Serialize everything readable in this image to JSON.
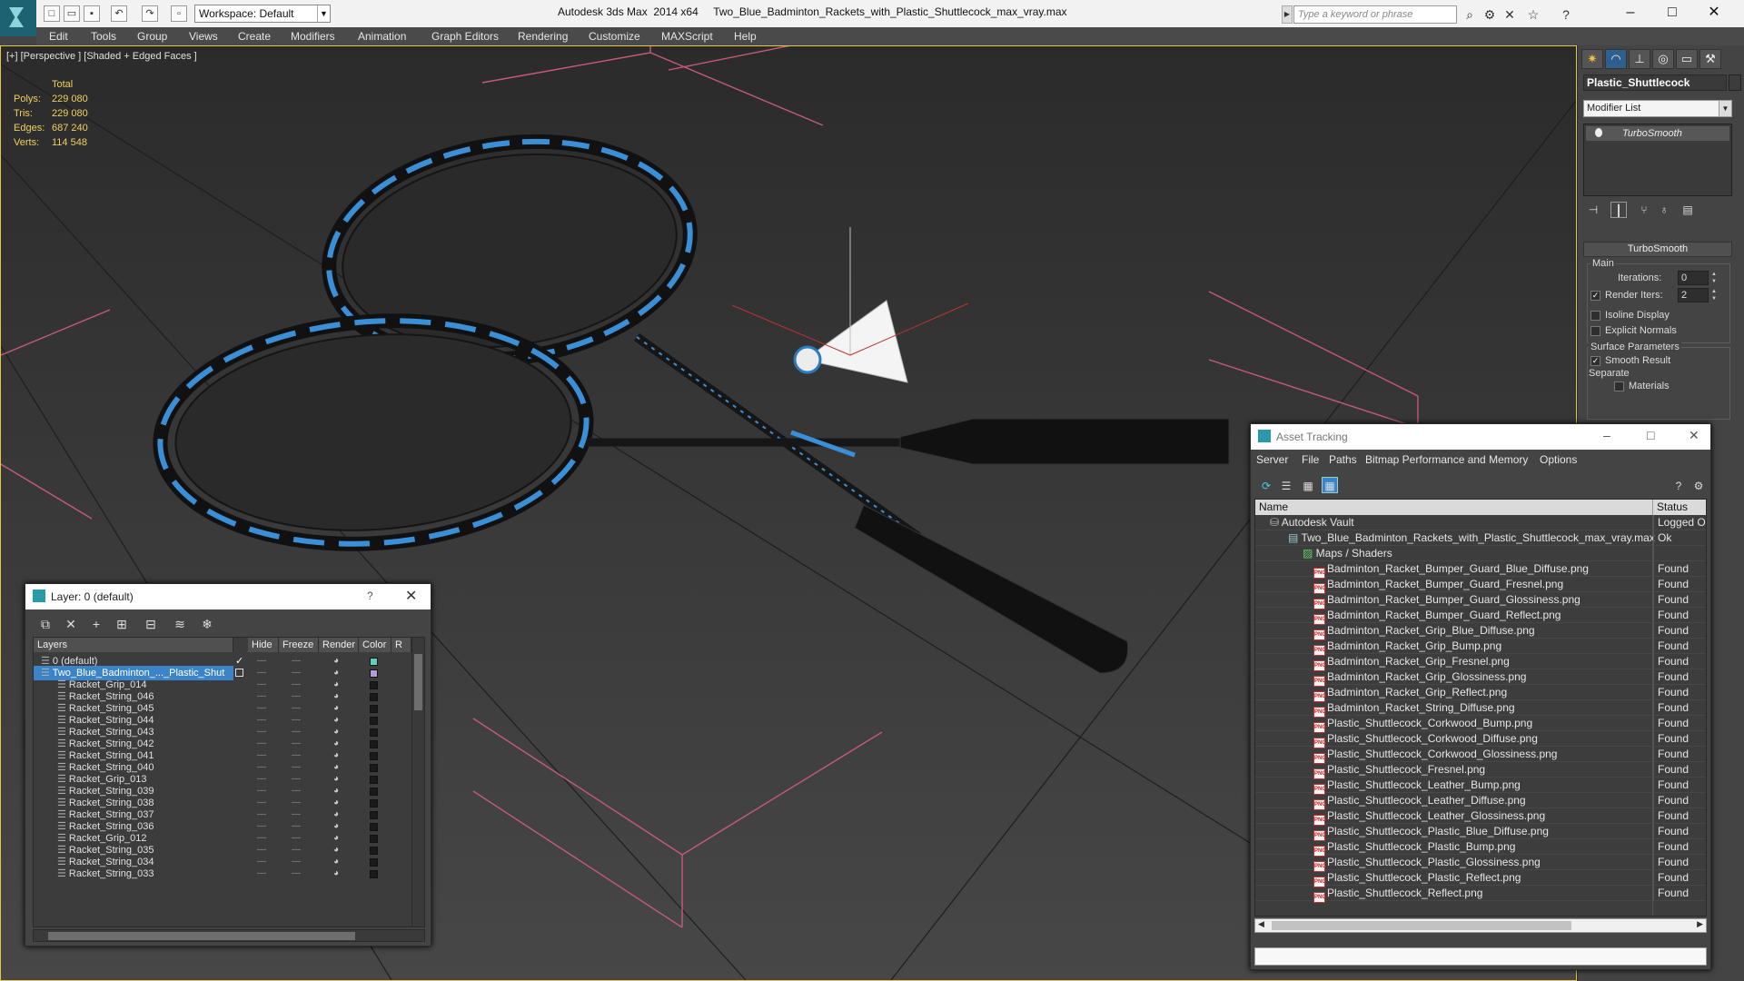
{
  "window": {
    "app_title": "Autodesk 3ds Max  2014 x64",
    "file_title": "Two_Blue_Badminton_Rackets_with_Plastic_Shuttlecock_max_vray.max",
    "workspace": "Workspace: Default",
    "search_placeholder": "Type a keyword or phrase"
  },
  "menu": [
    "Edit",
    "Tools",
    "Group",
    "Views",
    "Create",
    "Modifiers",
    "Animation",
    "Graph Editors",
    "Rendering",
    "Customize",
    "MAXScript",
    "Help"
  ],
  "viewport": {
    "label": "[+] [Perspective ] [Shaded + Edged Faces ]",
    "stats_header": "Total",
    "stats": [
      {
        "label": "Polys:",
        "value": "229 080"
      },
      {
        "label": "Tris:",
        "value": "229 080"
      },
      {
        "label": "Edges:",
        "value": "687 240"
      },
      {
        "label": "Verts:",
        "value": "114 548"
      }
    ]
  },
  "command_panel": {
    "object_name": "Plastic_Shuttlecock",
    "modifier_list": "Modifier List",
    "stack_item": "TurboSmooth",
    "rollout_title": "TurboSmooth",
    "main_label": "Main",
    "iterations_label": "Iterations:",
    "iterations_value": "0",
    "render_iters_label": "Render Iters:",
    "render_iters_value": "2",
    "isoline_label": "Isoline Display",
    "explicit_label": "Explicit Normals",
    "surface_label": "Surface Parameters",
    "smooth_label": "Smooth Result",
    "separate_label": "Separate",
    "materials_label": "Materials"
  },
  "layer_dialog": {
    "title": "Layer: 0 (default)",
    "help": "?",
    "columns": [
      "Layers",
      "Hide",
      "Freeze",
      "Render",
      "Color",
      "R"
    ],
    "rows": [
      {
        "name": "0 (default)",
        "color": "#5ed0c2",
        "indent": 1
      },
      {
        "name": "Two_Blue_Badminton_..._Plastic_Shut",
        "color": "#b49ad8",
        "indent": 1
      },
      {
        "name": "Racket_Grip_014",
        "color": "#1a1a1a",
        "indent": 2
      },
      {
        "name": "Racket_String_046",
        "color": "#1a1a1a",
        "indent": 2
      },
      {
        "name": "Racket_String_045",
        "color": "#1a1a1a",
        "indent": 2
      },
      {
        "name": "Racket_String_044",
        "color": "#1a1a1a",
        "indent": 2
      },
      {
        "name": "Racket_String_043",
        "color": "#1a1a1a",
        "indent": 2
      },
      {
        "name": "Racket_String_042",
        "color": "#1a1a1a",
        "indent": 2
      },
      {
        "name": "Racket_String_041",
        "color": "#1a1a1a",
        "indent": 2
      },
      {
        "name": "Racket_String_040",
        "color": "#1a1a1a",
        "indent": 2
      },
      {
        "name": "Racket_Grip_013",
        "color": "#1a1a1a",
        "indent": 2
      },
      {
        "name": "Racket_String_039",
        "color": "#1a1a1a",
        "indent": 2
      },
      {
        "name": "Racket_String_038",
        "color": "#1a1a1a",
        "indent": 2
      },
      {
        "name": "Racket_String_037",
        "color": "#1a1a1a",
        "indent": 2
      },
      {
        "name": "Racket_String_036",
        "color": "#1a1a1a",
        "indent": 2
      },
      {
        "name": "Racket_Grip_012",
        "color": "#1a1a1a",
        "indent": 2
      },
      {
        "name": "Racket_String_035",
        "color": "#1a1a1a",
        "indent": 2
      },
      {
        "name": "Racket_String_034",
        "color": "#1a1a1a",
        "indent": 2
      },
      {
        "name": "Racket_String_033",
        "color": "#1a1a1a",
        "indent": 2
      }
    ]
  },
  "asset_tracking": {
    "title": "Asset Tracking",
    "menu": [
      "Server",
      "File",
      "Paths",
      "Bitmap Performance and Memory",
      "Options"
    ],
    "columns": [
      "Name",
      "Status"
    ],
    "rows": [
      {
        "name": "Autodesk Vault",
        "status": "Logged Out",
        "icon": "vault"
      },
      {
        "name": "Two_Blue_Badminton_Rackets_with_Plastic_Shuttlecock_max_vray.max",
        "status": "Ok",
        "icon": "file"
      },
      {
        "name": "Maps / Shaders",
        "status": "",
        "icon": "folder"
      },
      {
        "name": "Badminton_Racket_Bumper_Guard_Blue_Diffuse.png",
        "status": "Found",
        "icon": "png"
      },
      {
        "name": "Badminton_Racket_Bumper_Guard_Fresnel.png",
        "status": "Found",
        "icon": "png"
      },
      {
        "name": "Badminton_Racket_Bumper_Guard_Glossiness.png",
        "status": "Found",
        "icon": "png"
      },
      {
        "name": "Badminton_Racket_Bumper_Guard_Reflect.png",
        "status": "Found",
        "icon": "png"
      },
      {
        "name": "Badminton_Racket_Grip_Blue_Diffuse.png",
        "status": "Found",
        "icon": "png"
      },
      {
        "name": "Badminton_Racket_Grip_Bump.png",
        "status": "Found",
        "icon": "png"
      },
      {
        "name": "Badminton_Racket_Grip_Fresnel.png",
        "status": "Found",
        "icon": "png"
      },
      {
        "name": "Badminton_Racket_Grip_Glossiness.png",
        "status": "Found",
        "icon": "png"
      },
      {
        "name": "Badminton_Racket_Grip_Reflect.png",
        "status": "Found",
        "icon": "png"
      },
      {
        "name": "Badminton_Racket_String_Diffuse.png",
        "status": "Found",
        "icon": "png"
      },
      {
        "name": "Plastic_Shuttlecock_Corkwood_Bump.png",
        "status": "Found",
        "icon": "png"
      },
      {
        "name": "Plastic_Shuttlecock_Corkwood_Diffuse.png",
        "status": "Found",
        "icon": "png"
      },
      {
        "name": "Plastic_Shuttlecock_Corkwood_Glossiness.png",
        "status": "Found",
        "icon": "png"
      },
      {
        "name": "Plastic_Shuttlecock_Fresnel.png",
        "status": "Found",
        "icon": "png"
      },
      {
        "name": "Plastic_Shuttlecock_Leather_Bump.png",
        "status": "Found",
        "icon": "png"
      },
      {
        "name": "Plastic_Shuttlecock_Leather_Diffuse.png",
        "status": "Found",
        "icon": "png"
      },
      {
        "name": "Plastic_Shuttlecock_Leather_Glossiness.png",
        "status": "Found",
        "icon": "png"
      },
      {
        "name": "Plastic_Shuttlecock_Plastic_Blue_Diffuse.png",
        "status": "Found",
        "icon": "png"
      },
      {
        "name": "Plastic_Shuttlecock_Plastic_Bump.png",
        "status": "Found",
        "icon": "png"
      },
      {
        "name": "Plastic_Shuttlecock_Plastic_Glossiness.png",
        "status": "Found",
        "icon": "png"
      },
      {
        "name": "Plastic_Shuttlecock_Plastic_Reflect.png",
        "status": "Found",
        "icon": "png"
      },
      {
        "name": "Plastic_Shuttlecock_Reflect.png",
        "status": "Found",
        "icon": "png"
      }
    ]
  },
  "colors": {
    "accent_blue": "#3b84c9",
    "racket_blue": "#3a8fd6",
    "viewport_border": "#e1c84a",
    "stats_yellow": "#f0d060"
  }
}
